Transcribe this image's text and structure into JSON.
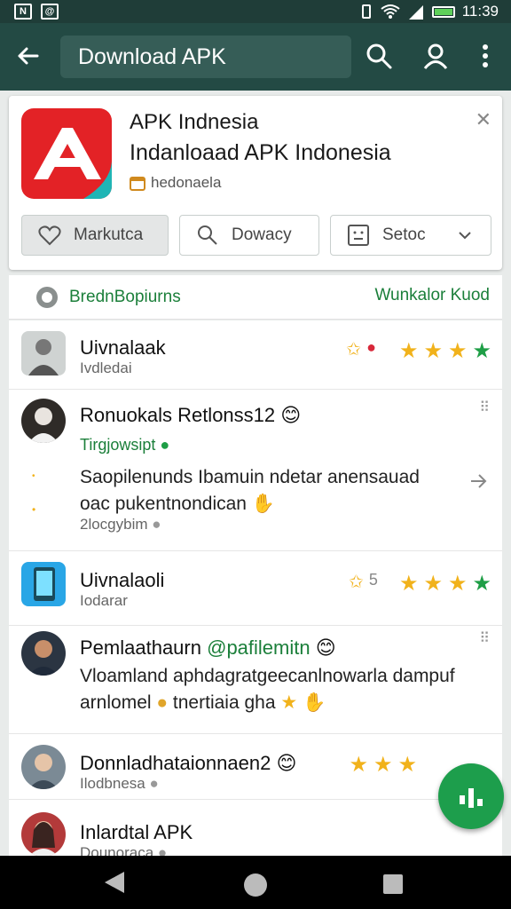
{
  "status_bar": {
    "time": "11:39",
    "left_icons": [
      "N",
      "@"
    ],
    "battery_color": "#5ed05a"
  },
  "app_bar": {
    "title": "Download APK",
    "back_icon": "arrow-left-icon",
    "icons": [
      "search-icon",
      "profile-icon",
      "more-vert-icon"
    ],
    "color": "#234a44"
  },
  "app_card": {
    "name": "APK Indnesia",
    "subtitle": "Indanloaad APK Indonesia",
    "developer": "hedonaela",
    "close_icon": "close-icon",
    "buttons": [
      {
        "label": "Markutca",
        "icon": "heart-icon"
      },
      {
        "label": "Dowacy",
        "icon": "search-icon"
      },
      {
        "label": "Setoc",
        "icon": "face-icon"
      }
    ]
  },
  "tab_row": {
    "left_label": "BrednBopiurns",
    "right_label": "Wunkalor Kuod",
    "accent": "#1b7f3a"
  },
  "feed": [
    {
      "name": "Uivnalaak",
      "sub": "Ivdledai",
      "stars_label": "",
      "rating_stars": 4
    },
    {
      "name": "Ronuokals Retlonss12",
      "emoji": "😊",
      "green": "Tirgjowsipt",
      "body_line1": "Saopilenunds Ibamuin ndetar anensauad",
      "body_line2": "oac pukentnondican",
      "meta": "2locgybim"
    },
    {
      "name": "Uivnalaoli",
      "sub": "Iodarar",
      "stars_label": "5",
      "rating_stars": 4
    },
    {
      "name": "Pemlaathaurn",
      "handle": "@pafilemitn",
      "emoji": "😊",
      "body_line1": "Vloamland aphdagratgeecanlnowarla dampuf",
      "body_line2": "arnlomel",
      "body_line2b": "tnertiaia gha"
    },
    {
      "name": "Donnladhataionnaen2",
      "emoji": "😊",
      "sub": "Ilodbnesa",
      "rating_stars": 3
    },
    {
      "name": "Inlardtal APK",
      "sub": "Dounoraca"
    }
  ],
  "fab_icon": "edit-icon",
  "nav": {
    "icons": [
      "back-icon",
      "home-icon",
      "recents-icon"
    ]
  }
}
